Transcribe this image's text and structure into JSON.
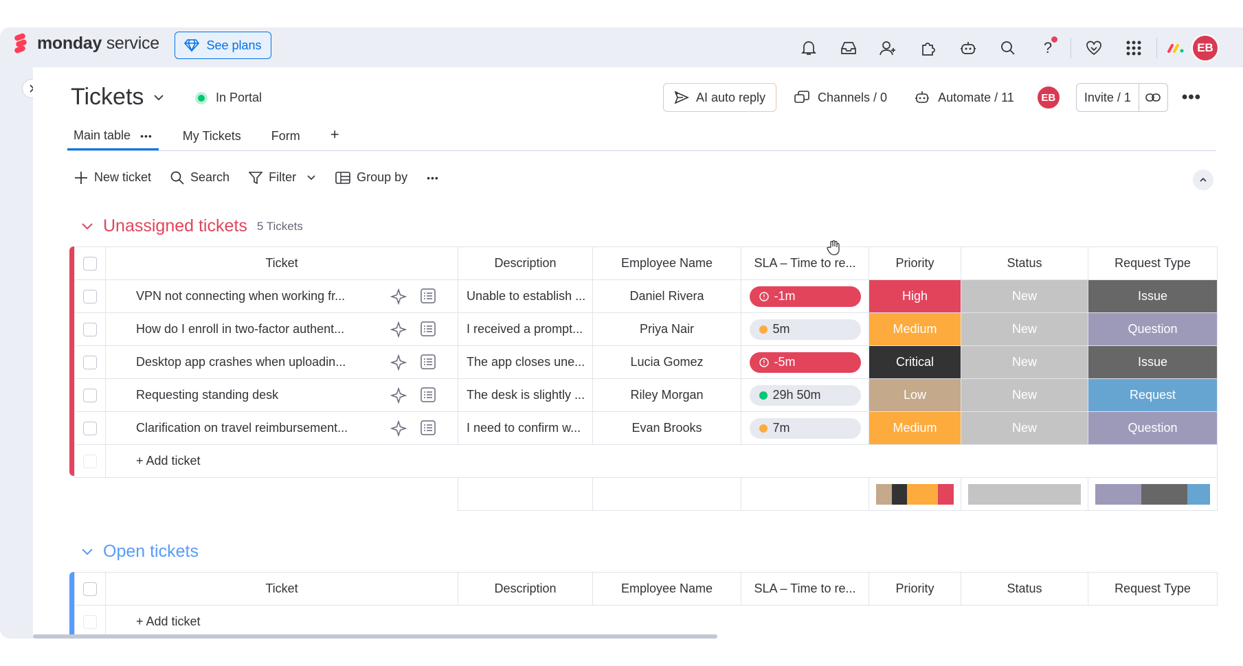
{
  "app": {
    "brand_bold": "monday",
    "brand_light": " service",
    "see_plans": "See plans",
    "avatar": "EB"
  },
  "topbar_icons": [
    "bell-icon",
    "inbox-icon",
    "invite-member-icon",
    "integrations-icon",
    "bot-icon",
    "search-icon",
    "help-icon",
    "favorites-icon",
    "apps-grid-icon"
  ],
  "board": {
    "title": "Tickets",
    "portal_label": "In Portal"
  },
  "header_actions": {
    "ai_reply": "AI auto reply",
    "channels": "Channels / 0",
    "automate": "Automate / 11",
    "avatar": "EB",
    "invite": "Invite / 1"
  },
  "tabs": [
    {
      "label": "Main table",
      "active": true
    },
    {
      "label": "My Tickets"
    },
    {
      "label": "Form"
    }
  ],
  "toolbar": {
    "new_ticket": "New ticket",
    "search": "Search",
    "filter": "Filter",
    "group_by": "Group by"
  },
  "columns": [
    "Ticket",
    "Description",
    "Employee Name",
    "SLA – Time to re...",
    "Priority",
    "Status",
    "Request Type"
  ],
  "colors": {
    "High": "#e2445c",
    "Medium": "#fdab3d",
    "Critical": "#333333",
    "Low": "#c4a98a",
    "New": "#c4c4c4",
    "Issue": "#676767",
    "Question": "#9d99b9",
    "Request": "#66a5d1",
    "unassigned": "#e2445c",
    "open": "#579bfc"
  },
  "groups": {
    "unassigned": {
      "name": "Unassigned tickets",
      "count": "5 Tickets",
      "add_label": "+ Add ticket",
      "rows": [
        {
          "ticket": "VPN not connecting when working fr...",
          "description": "Unable to establish ...",
          "employee": "Daniel Rivera",
          "sla": "-1m",
          "sla_state": "overdue",
          "priority": "High",
          "status": "New",
          "type": "Issue"
        },
        {
          "ticket": "How do I enroll in two-factor authent...",
          "description": "I received a prompt...",
          "employee": "Priya Nair",
          "sla": "5m",
          "sla_state": "warning",
          "priority": "Medium",
          "status": "New",
          "type": "Question"
        },
        {
          "ticket": "Desktop app crashes when uploadin...",
          "description": "The app closes une...",
          "employee": "Lucia Gomez",
          "sla": "-5m",
          "sla_state": "overdue",
          "priority": "Critical",
          "status": "New",
          "type": "Issue"
        },
        {
          "ticket": "Requesting standing desk",
          "description": "The desk is slightly ...",
          "employee": "Riley Morgan",
          "sla": "29h 50m",
          "sla_state": "ok",
          "priority": "Low",
          "status": "New",
          "type": "Request"
        },
        {
          "ticket": "Clarification on travel reimbursement...",
          "description": "I need to confirm w...",
          "employee": "Evan Brooks",
          "sla": "7m",
          "sla_state": "warning",
          "priority": "Medium",
          "status": "New",
          "type": "Question"
        }
      ],
      "summary": {
        "priority": [
          {
            "label": "Low",
            "share": 0.2
          },
          {
            "label": "Critical",
            "share": 0.2
          },
          {
            "label": "Medium",
            "share": 0.4
          },
          {
            "label": "High",
            "share": 0.2
          }
        ],
        "status": [
          {
            "label": "New",
            "share": 1.0
          }
        ],
        "type": [
          {
            "label": "Question",
            "share": 0.4
          },
          {
            "label": "Issue",
            "share": 0.4
          },
          {
            "label": "Request",
            "share": 0.2
          }
        ]
      }
    },
    "open": {
      "name": "Open tickets",
      "add_label": "+ Add ticket"
    }
  }
}
